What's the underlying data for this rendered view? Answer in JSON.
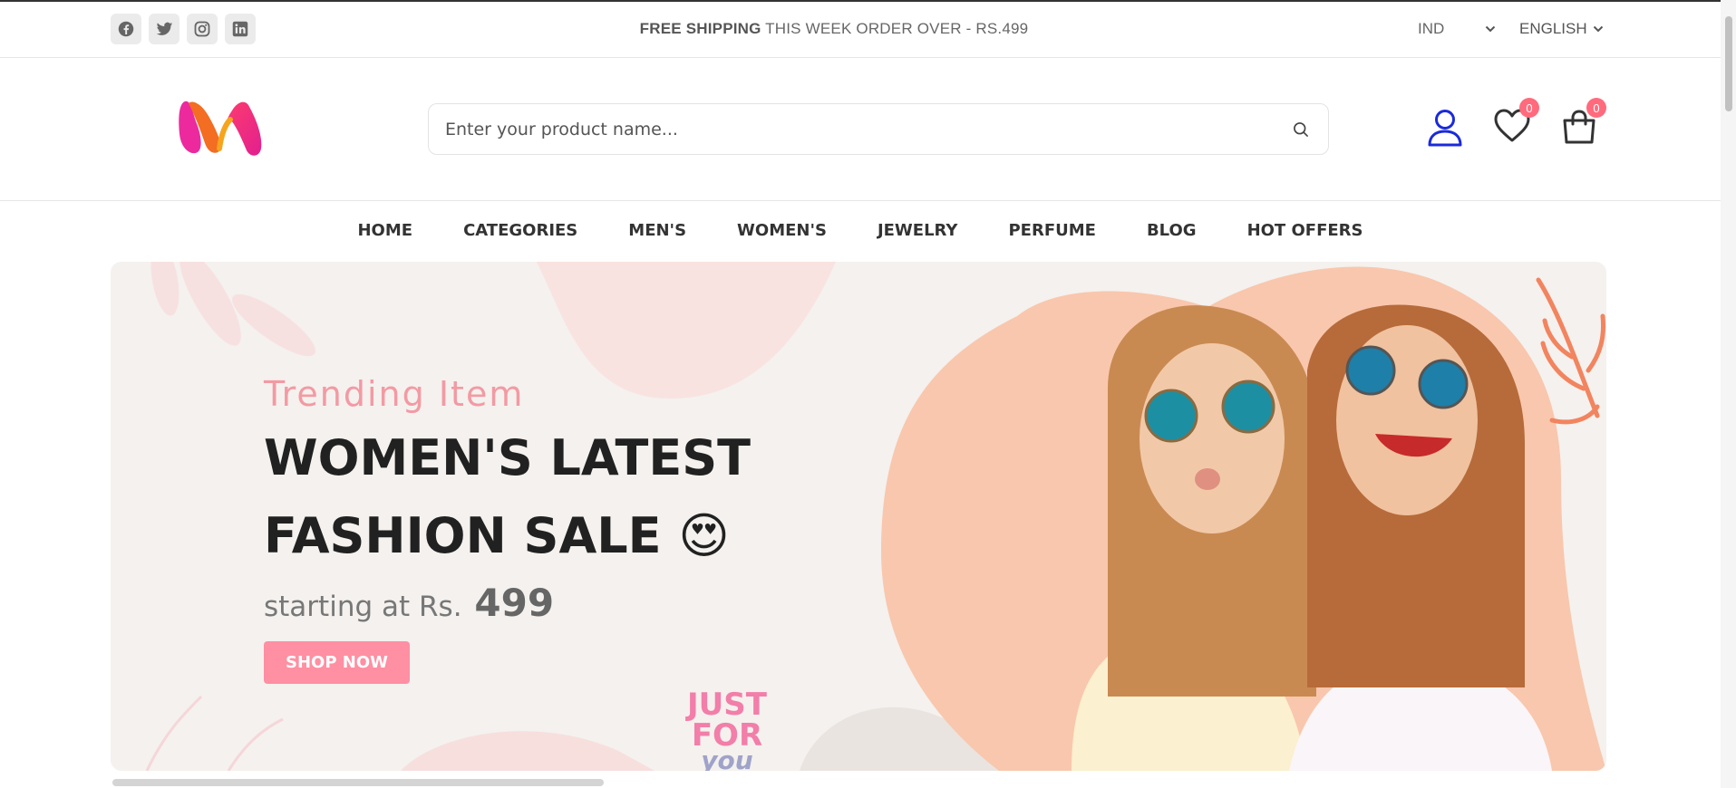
{
  "topbar": {
    "social": [
      "facebook-icon",
      "twitter-icon",
      "instagram-icon",
      "linkedin-icon"
    ],
    "shipping_bold": "FREE SHIPPING",
    "shipping_rest": " THIS WEEK ORDER OVER - RS.499",
    "currency": "IND",
    "language": "ENGLISH"
  },
  "header": {
    "search_placeholder": "Enter your product name...",
    "wishlist_count": "0",
    "cart_count": "0"
  },
  "nav": [
    "HOME",
    "CATEGORIES",
    "MEN'S",
    "WOMEN'S",
    "JEWELRY",
    "PERFUME",
    "BLOG",
    "HOT OFFERS"
  ],
  "hero": {
    "subtitle": "Trending Item",
    "headline_line1": "WOMEN'S LATEST",
    "headline_line2": "FASHION SALE",
    "emoji": "😍",
    "starting_text": "starting at Rs.",
    "price": "499",
    "cta": "SHOP NOW",
    "decor_line1": "JUST",
    "decor_line2": "FOR",
    "decor_line3": "you"
  },
  "colors": {
    "accent_pink": "#ff8fa2",
    "badge": "#ff6b7d",
    "user_icon": "#1a2adb",
    "hero_bg": "#f4f1ee",
    "heart_blob": "#f9c7ad"
  }
}
